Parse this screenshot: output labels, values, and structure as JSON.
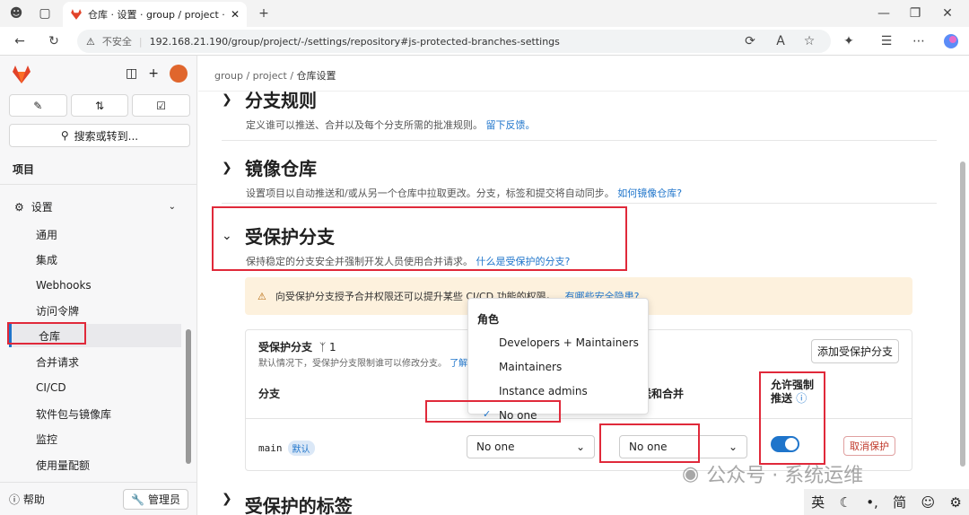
{
  "browser": {
    "tab_title": "仓库 · 设置 · group / project · Gitl",
    "insecure_label": "不安全",
    "url": "192.168.21.190/group/project/-/settings/repository#js-protected-branches-settings"
  },
  "sidebar": {
    "search_label": "搜索或转到...",
    "section": "项目",
    "settings_label": "设置",
    "items": [
      {
        "label": "通用"
      },
      {
        "label": "集成"
      },
      {
        "label": "Webhooks"
      },
      {
        "label": "访问令牌"
      },
      {
        "label": "仓库"
      },
      {
        "label": "合并请求"
      },
      {
        "label": "CI/CD"
      },
      {
        "label": "软件包与镜像库"
      },
      {
        "label": "监控"
      },
      {
        "label": "使用量配额"
      }
    ],
    "help_label": "帮助",
    "admin_label": "管理员"
  },
  "breadcrumb": {
    "group": "group",
    "project": "project",
    "current": "仓库设置"
  },
  "sections": {
    "branch_rules": {
      "title": "分支规则",
      "desc": "定义谁可以推送、合并以及每个分支所需的批准规则。",
      "link": "留下反馈。"
    },
    "mirror": {
      "title": "镜像仓库",
      "desc": "设置项目以自动推送和/或从另一个仓库中拉取更改。分支，标签和提交将自动同步。",
      "link": "如何镜像仓库?"
    },
    "protected": {
      "title": "受保护分支",
      "desc": "保持稳定的分支安全并强制开发人员使用合并请求。",
      "link": "什么是受保护的分支?"
    },
    "next": {
      "title": "受保护的标签"
    }
  },
  "warning": {
    "text": "向受保护分支授予合并权限还可以提升某些 CI/CD 功能的权限。",
    "link": "有哪些安全隐患?"
  },
  "card": {
    "title": "受保护分支",
    "count": "1",
    "subtitle": "默认情况下，受保护分支限制谁可以修改分支。",
    "subtitle_link": "了解",
    "add_button": "添加受保护分支",
    "col_branch": "分支",
    "col_push": "送和合并",
    "col_force_1": "允许强制",
    "col_force_2": "推送",
    "branch_name": "main",
    "default_badge": "默认",
    "merge_value": "No one",
    "push_value": "No one",
    "unprotect_button": "取消保护",
    "force_push_enabled": true
  },
  "dropdown": {
    "header": "角色",
    "options": [
      {
        "label": "Developers + Maintainers",
        "selected": false
      },
      {
        "label": "Maintainers",
        "selected": false
      },
      {
        "label": "Instance admins",
        "selected": false
      },
      {
        "label": "No one",
        "selected": true
      }
    ]
  },
  "watermark": "公众号 · 系统运维",
  "ime": {
    "lang": "英",
    "mode": "简"
  },
  "colors": {
    "accent": "#1f75cb",
    "highlight": "#e0293a",
    "warn_bg": "#fdf1dd"
  }
}
